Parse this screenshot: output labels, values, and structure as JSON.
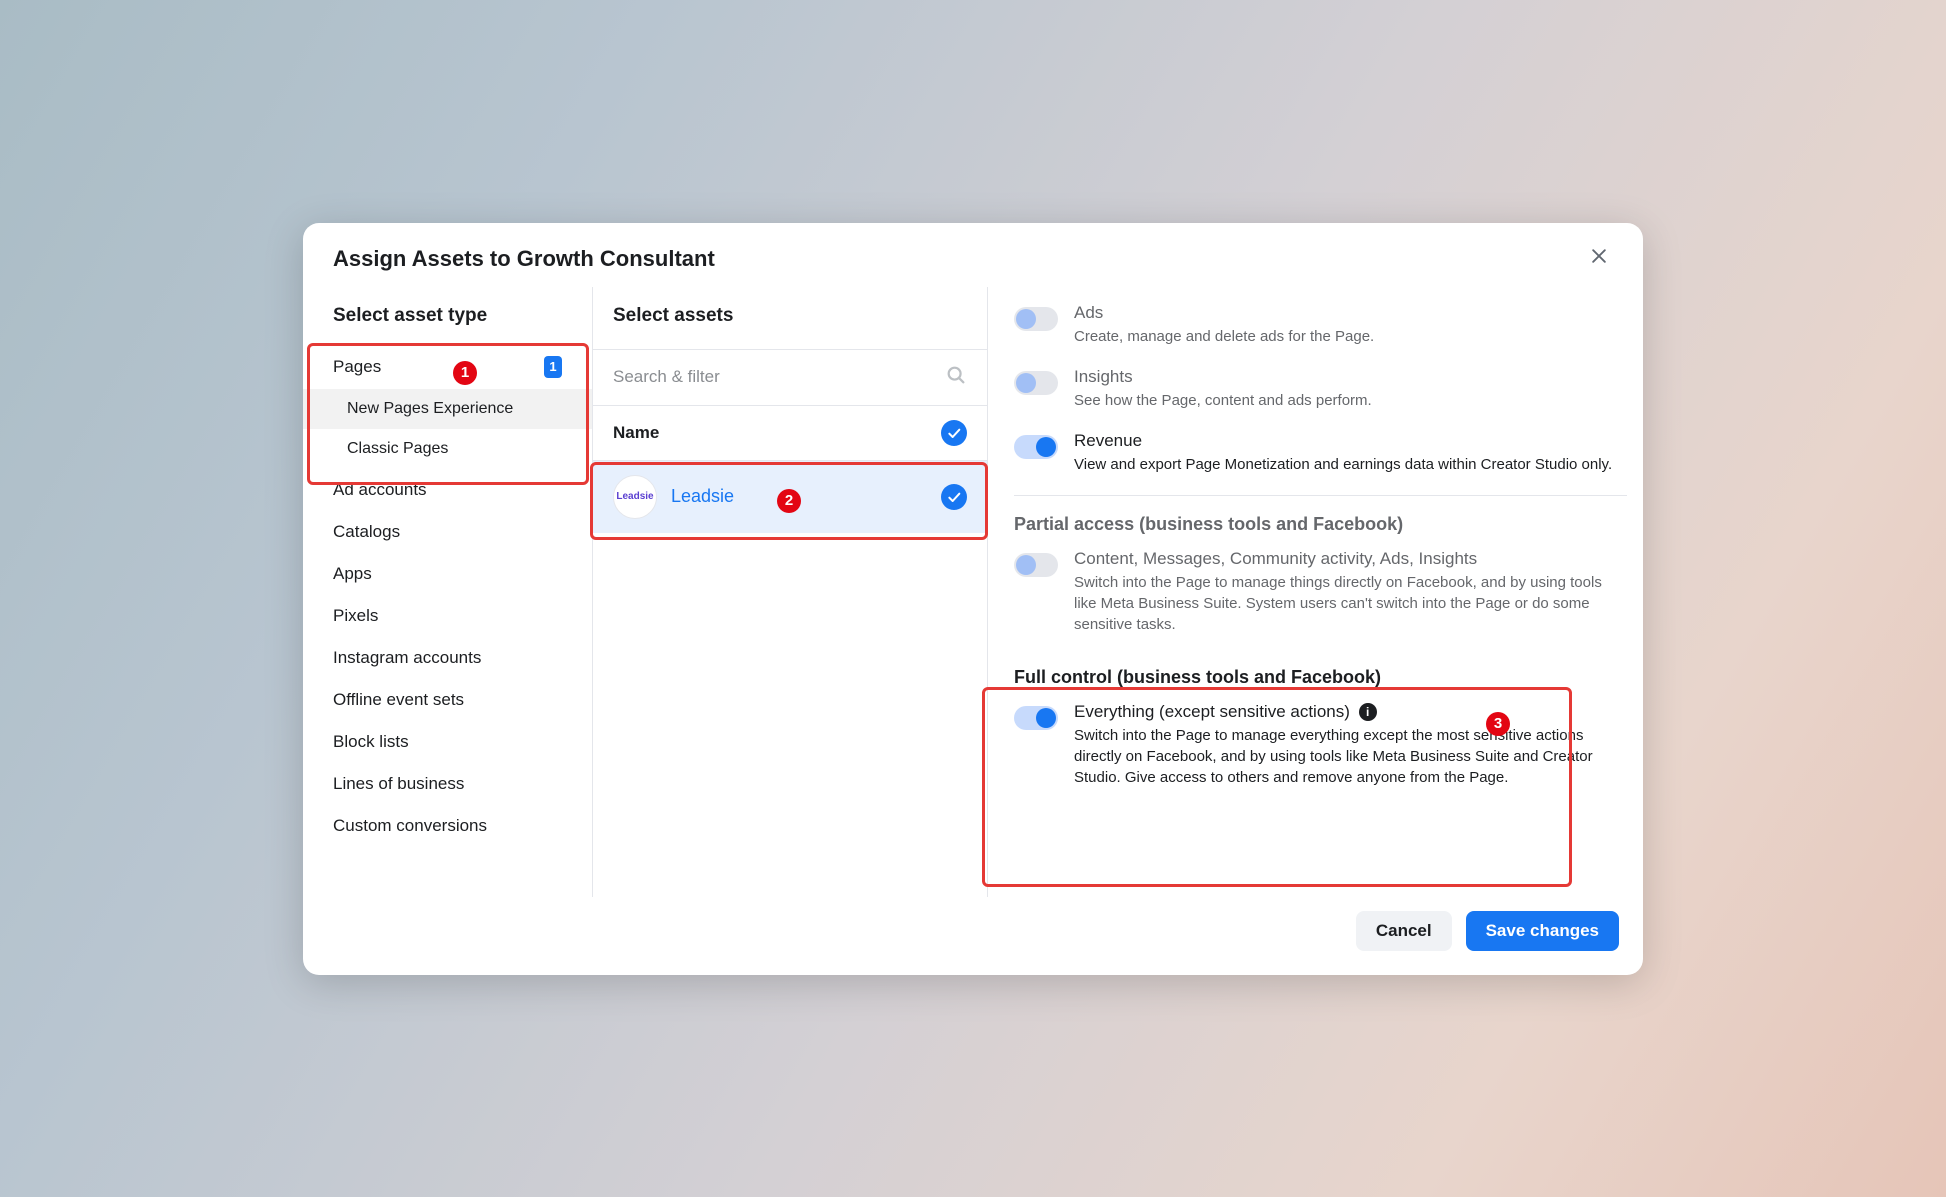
{
  "modal": {
    "title": "Assign Assets to Growth Consultant",
    "close_aria": "Close"
  },
  "leftCol": {
    "heading": "Select asset type",
    "pages_label": "Pages",
    "pages_count": "1",
    "sub_new": "New Pages Experience",
    "sub_classic": "Classic Pages",
    "ad_accounts": "Ad accounts",
    "catalogs": "Catalogs",
    "apps": "Apps",
    "pixels": "Pixels",
    "instagram": "Instagram accounts",
    "offline": "Offline event sets",
    "block": "Block lists",
    "lob": "Lines of business",
    "custom": "Custom conversions"
  },
  "midCol": {
    "heading": "Select assets",
    "search_placeholder": "Search & filter",
    "name_header": "Name",
    "asset_name": "Leadsie",
    "asset_avatar_text": "Leadsie"
  },
  "rightCol": {
    "ads_title": "Ads",
    "ads_desc": "Create, manage and delete ads for the Page.",
    "insights_title": "Insights",
    "insights_desc": "See how the Page, content and ads perform.",
    "revenue_title": "Revenue",
    "revenue_desc": "View and export Page Monetization and earnings data within Creator Studio only.",
    "partial_header": "Partial access (business tools and Facebook)",
    "partial_title": "Content, Messages, Community activity, Ads, Insights",
    "partial_desc": "Switch into the Page to manage things directly on Facebook, and by using tools like Meta Business Suite. System users can't switch into the Page or do some sensitive tasks.",
    "full_header": "Full control (business tools and Facebook)",
    "full_title": "Everything (except sensitive actions)",
    "full_desc": "Switch into the Page to manage everything except the most sensitive actions directly on Facebook, and by using tools like Meta Business Suite and Creator Studio. Give access to others and remove anyone from the Page."
  },
  "footer": {
    "cancel": "Cancel",
    "save": "Save changes"
  },
  "annotations": {
    "n1": "1",
    "n2": "2",
    "n3": "3"
  }
}
